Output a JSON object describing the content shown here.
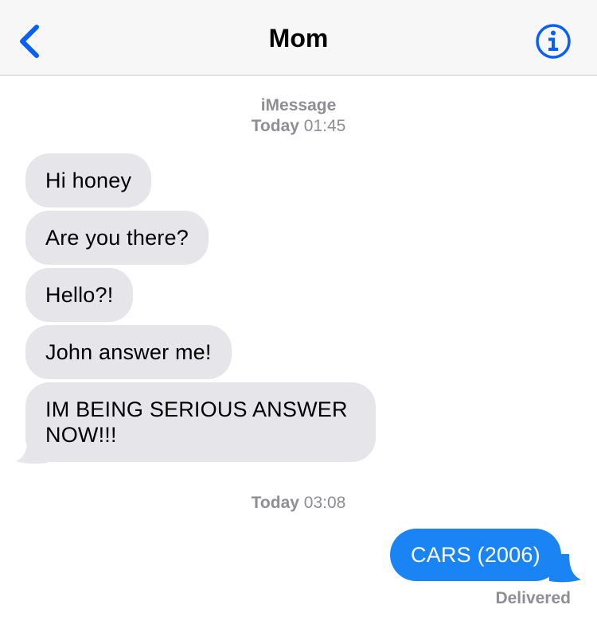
{
  "header": {
    "title": "Mom",
    "back_icon": "chevron-left-icon",
    "info_icon": "info-circle-icon",
    "accent": "#0a5ff5"
  },
  "conversation": {
    "service": "iMessage",
    "timestamp_1": {
      "day": "Today",
      "time": "01:45"
    },
    "incoming_messages": [
      "Hi honey",
      "Are you there?",
      "Hello?!",
      "John answer me!",
      "IM BEING SERIOUS ANSWER NOW!!!"
    ],
    "timestamp_2": {
      "day": "Today",
      "time": "03:08"
    },
    "outgoing_messages": [
      "CARS (2006)"
    ],
    "status": "Delivered"
  },
  "colors": {
    "incoming_bubble": "#e5e5ea",
    "outgoing_bubble": "#1a84f5",
    "meta_text": "#8e8e93"
  }
}
